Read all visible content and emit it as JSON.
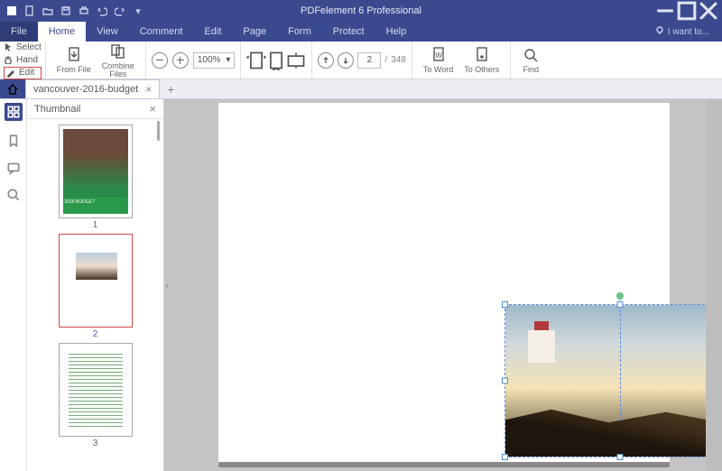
{
  "app": {
    "title": "PDFelement 6 Professional"
  },
  "menubar": {
    "file": "File",
    "items": [
      "Home",
      "View",
      "Comment",
      "Edit",
      "Page",
      "Form",
      "Protect",
      "Help"
    ],
    "active_index": 0,
    "iwant": "I want to..."
  },
  "ribbon": {
    "left_tools": {
      "select": "Select",
      "hand": "Hand",
      "edit": "Edit"
    },
    "from_file": "From File",
    "combine_files": "Combine\nFiles",
    "zoom_value": "100%",
    "page_current": "2",
    "page_sep": "/",
    "page_total": "348",
    "to_word": "To Word",
    "to_others": "To Others",
    "find": "Find"
  },
  "tabs": {
    "doc_name": "vancouver-2016-budget"
  },
  "thumbnail": {
    "title": "Thumbnail",
    "pages": [
      "1",
      "2",
      "3"
    ],
    "selected_index": 1
  },
  "colors": {
    "primary": "#3b4a8f"
  }
}
